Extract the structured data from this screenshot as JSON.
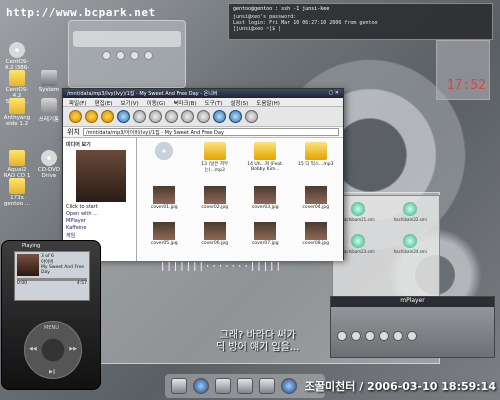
{
  "watermark": "http://www.bcpark.net",
  "desktop_icons": [
    {
      "label": "CentOS-4.2 i386-bin"
    },
    {
      "label": "CentOS-4.2 Server..."
    },
    {
      "label": "System"
    },
    {
      "label": "Anthyang eide 1.2"
    },
    {
      "label": "쓰레기통"
    },
    {
      "label": "Aqual2 RAD CD 1"
    },
    {
      "label": "CD-DVD Drive"
    },
    {
      "label": "173x gentoo ..."
    }
  ],
  "terminal": {
    "title": "gentoo@gentoo : ssh -1 junsi-kee",
    "lines": [
      "junsi@xeo's password:",
      "Last login: Fri Mar 10 06:27:10 2006 from gentoo",
      "[junsi@xeo ~]$ |"
    ]
  },
  "clock_widget": {
    "time": "17:52"
  },
  "file_manager": {
    "title": "/mnt/data/mp3/Ivy(Ivy)/1집 - My Sweet And Free Day - 온니버",
    "menu": [
      "파일(F)",
      "편집(E)",
      "보기(V)",
      "이동(G)",
      "북마크(B)",
      "도구(T)",
      "설정(S)",
      "도움말(H)"
    ],
    "location_label": "위치",
    "location_value": "/mnt/data/mp3/아이비(Ivy)/1집 - My Sweet And Free Day",
    "sidebar": {
      "heading": "미디어 보기",
      "caption": "Click to start",
      "links": [
        "Open with ...",
        "MPlayer",
        "Kaffeine",
        "게임",
        "재생"
      ]
    },
    "files": [
      {
        "name": "",
        "type": "cd"
      },
      {
        "name": "13 (날은 저무는)...mp3",
        "type": "mp3"
      },
      {
        "name": "14 Uh...쳐 (Feat. Bobby Kim...",
        "type": "mp3"
      },
      {
        "name": "15 디 믹스...mp3",
        "type": "mp3"
      },
      {
        "name": "cover01.jpg",
        "type": "jpg"
      },
      {
        "name": "cover02.jpg",
        "type": "jpg"
      },
      {
        "name": "cover03.jpg",
        "type": "jpg"
      },
      {
        "name": "cover04.jpg",
        "type": "jpg"
      },
      {
        "name": "cover05.jpg",
        "type": "jpg"
      },
      {
        "name": "cover06.jpg",
        "type": "jpg"
      },
      {
        "name": "cover07.jpg",
        "type": "jpg"
      },
      {
        "name": "cover08.jpg",
        "type": "jpg"
      }
    ]
  },
  "ghost_files": [
    "hachibam21.smi",
    "hachibam22.smi",
    "hachibam23.smi",
    "hachibam24.smi"
  ],
  "ipod": {
    "title": "Playing",
    "track": "3 of 6",
    "artist": "아이비",
    "song": "My Sweet And Free Day",
    "elapsed": "0:00",
    "remaining": "4:57",
    "menu": "MENU"
  },
  "visualizer": "|||||||·······|||||",
  "subtitle": [
    "그래? 바라다 써가",
    "딕 방어 얘기 입을..."
  ],
  "mplayer": {
    "title": "mPlayer"
  },
  "timestamp": "조꿀미천터 / 2006-03-10 18:59:14"
}
